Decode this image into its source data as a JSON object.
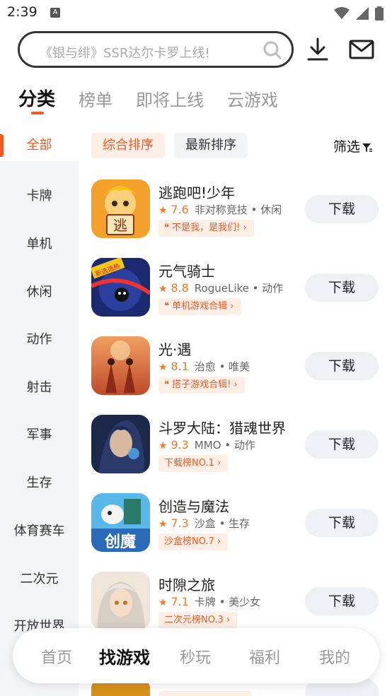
{
  "status": {
    "time": "2:39",
    "notification_icon": "A"
  },
  "search": {
    "placeholder": "《银与绯》SSR达尔卡罗上线!"
  },
  "tabs": [
    {
      "label": "分类"
    },
    {
      "label": "榜单"
    },
    {
      "label": "即将上线"
    },
    {
      "label": "云游戏"
    }
  ],
  "sidebar": {
    "items": [
      {
        "label": "全部"
      },
      {
        "label": "卡牌"
      },
      {
        "label": "单机"
      },
      {
        "label": "休闲"
      },
      {
        "label": "动作"
      },
      {
        "label": "射击"
      },
      {
        "label": "军事"
      },
      {
        "label": "生存"
      },
      {
        "label": "体育赛车"
      },
      {
        "label": "二次元"
      },
      {
        "label": "开放世界"
      }
    ]
  },
  "sort": {
    "composite": "综合排序",
    "latest": "最新排序",
    "filter": "筛选"
  },
  "games": [
    {
      "title": "逃跑吧!少年",
      "rating": "7.6",
      "tags": "非对称竞技 • 休闲",
      "badge": "不是我，是我们!",
      "button": "下载",
      "icon_text": "逃"
    },
    {
      "title": "元气骑士",
      "rating": "8.8",
      "tags": "RogueLike • 动作",
      "badge": "单机游戏合辑",
      "button": "下载",
      "icon_text": "新选选热"
    },
    {
      "title": "光·遇",
      "rating": "8.1",
      "tags": "治愈 • 唯美",
      "badge": "搭子游戏合辑!",
      "button": "下载"
    },
    {
      "title": "斗罗大陆：猎魂世界",
      "rating": "9.3",
      "tags": "MMO • 动作",
      "badge": "下载榜NO.1",
      "button": "下载"
    },
    {
      "title": "创造与魔法",
      "rating": "7.3",
      "tags": "沙盒 • 生存",
      "badge": "沙盒榜NO.7",
      "button": "下载",
      "icon_text": "创魔"
    },
    {
      "title": "时隙之旅",
      "rating": "7.1",
      "tags": "卡牌 • 美少女",
      "badge": "二次元榜NO.3",
      "button": "下载"
    }
  ],
  "bottom_nav": [
    {
      "label": "首页"
    },
    {
      "label": "找游戏"
    },
    {
      "label": "秒玩"
    },
    {
      "label": "福利"
    },
    {
      "label": "我的"
    }
  ],
  "colors": {
    "accent": "#f05a22",
    "rating": "#f07a2a",
    "sidebar_bg": "#f4f5f7",
    "button_bg": "#eef0f4"
  }
}
